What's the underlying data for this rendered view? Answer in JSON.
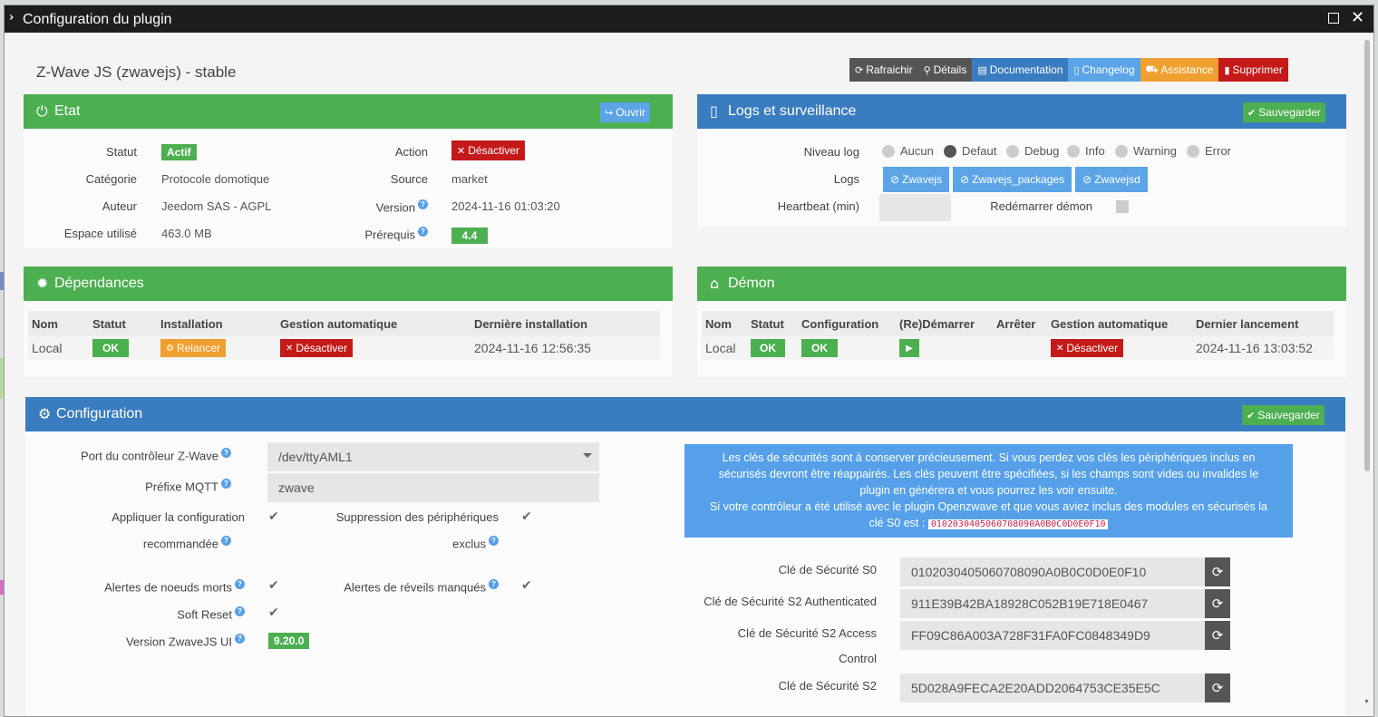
{
  "window": {
    "title": "Configuration du plugin"
  },
  "plugin": {
    "title": "Z-Wave JS (zwavejs) - stable"
  },
  "toolbar": [
    {
      "label": "Rafraichir",
      "icon": "⟳",
      "color": "#555555"
    },
    {
      "label": "Détails",
      "icon": "🔍",
      "color": "#555555"
    },
    {
      "label": "Documentation",
      "icon": "▤",
      "color": "#3a7cc0"
    },
    {
      "label": "Changelog",
      "icon": "▯",
      "color": "#5ba4e6"
    },
    {
      "label": "Assistance",
      "icon": "⛟",
      "color": "#f0a030"
    },
    {
      "label": "Supprimer",
      "icon": "🗑",
      "color": "#c41a1a"
    }
  ],
  "etat": {
    "title": "Etat",
    "open_label": "Ouvrir",
    "statut_label": "Statut",
    "statut_value": "Actif",
    "categorie_label": "Catégorie",
    "categorie_value": "Protocole domotique",
    "auteur_label": "Auteur",
    "auteur_value": "Jeedom SAS - AGPL",
    "espace_label": "Espace utilisé",
    "espace_value": "463.0 MB",
    "action_label": "Action",
    "action_value": "Désactiver",
    "source_label": "Source",
    "source_value": "market",
    "version_label": "Version",
    "version_value": "2024-11-16 01:03:20",
    "prerequis_label": "Prérequis",
    "prerequis_value": "4.4"
  },
  "logs": {
    "title": "Logs et surveillance",
    "save_label": "Sauvegarder",
    "niveau_label": "Niveau log",
    "levels": [
      "Aucun",
      "Defaut",
      "Debug",
      "Info",
      "Warning",
      "Error"
    ],
    "selected_level": "Defaut",
    "logs_label": "Logs",
    "log_buttons": [
      "Zwavejs",
      "Zwavejs_packages",
      "Zwavejsd"
    ],
    "heartbeat_label": "Heartbeat (min)",
    "heartbeat_value": "",
    "restart_label": "Redémarrer démon"
  },
  "dependances": {
    "title": "Dépendances",
    "headers": [
      "Nom",
      "Statut",
      "Installation",
      "Gestion automatique",
      "Dernière installation"
    ],
    "row": {
      "nom": "Local",
      "statut": "OK",
      "installation": "Relancer",
      "gestion": "Désactiver",
      "derniere": "2024-11-16 12:56:35"
    }
  },
  "demon": {
    "title": "Démon",
    "headers": [
      "Nom",
      "Statut",
      "Configuration",
      "(Re)Démarrer",
      "Arrêter",
      "Gestion automatique",
      "Dernier lancement"
    ],
    "row": {
      "nom": "Local",
      "statut": "OK",
      "configuration": "OK",
      "gestion": "Désactiver",
      "dernier": "2024-11-16 13:03:52"
    }
  },
  "configuration": {
    "title": "Configuration",
    "save_label": "Sauvegarder",
    "port_label": "Port du contrôleur Z-Wave",
    "port_value": "/dev/ttyAML1",
    "prefix_label": "Préfixe MQTT",
    "prefix_value": "zwave",
    "apply_label_1": "Appliquer la configuration",
    "apply_label_2": "recommandée",
    "suppression_label_1": "Suppression des périphériques",
    "suppression_label_2": "exclus",
    "dead_label": "Alertes de noeuds morts",
    "wake_label": "Alertes de réveils manqués",
    "soft_label": "Soft Reset",
    "version_label": "Version ZwaveJS UI",
    "version_value": "9.20.0",
    "info_line1": "Les clés de sécurités sont à conserver précieusement. Si vous perdez vos clés les périphériques inclus en",
    "info_line2": "sécurisés devront être réappairés. Les clés peuvent être spécifiées, si les champs sont vides ou invalides le",
    "info_line3": "plugin en générera et vous pourrez les voir ensuite.",
    "info_line4": "Si votre contrôleur a été utilisé avec le plugin Openzwave et que vous aviez inclus des modules en sécurisés la",
    "info_line5": "clé S0 est :",
    "info_code": "0102030405060708090A0B0C0D0E0F10",
    "s0_label": "Clé de Sécurité S0",
    "s0_value": "0102030405060708090A0B0C0D0E0F10",
    "s2auth_label": "Clé de Sécurité S2 Authenticated",
    "s2auth_value": "911E39B42BA18928C052B19E718E0467",
    "s2access_label_1": "Clé de Sécurité S2 Access",
    "s2access_label_2": "Control",
    "s2access_value": "FF09C86A003A728F31FA0FC0848349D9",
    "s2un_label": "Clé de Sécurité S2",
    "s2un_value": "5D028A9FECA2E20ADD2064753CE35E5C"
  },
  "colors": {
    "green": "#4caf50",
    "blue": "#3a7cc0",
    "red": "#c41a1a",
    "orange": "#f0a030",
    "lightblue": "#5ba4e6"
  }
}
